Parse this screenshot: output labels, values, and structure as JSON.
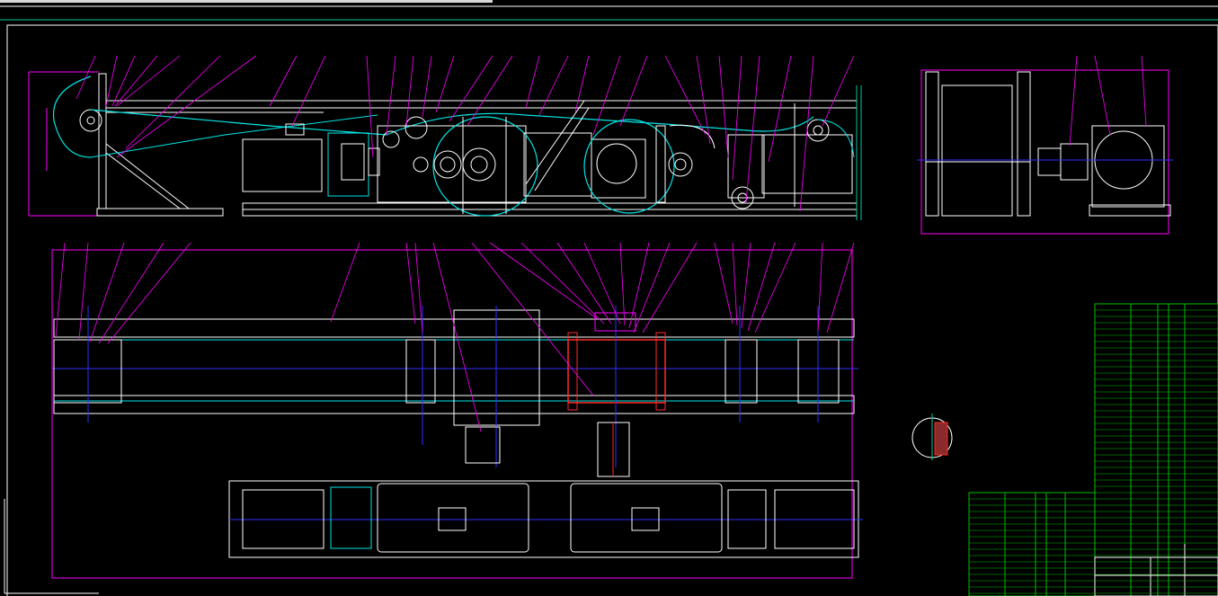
{
  "drawing": {
    "background": "#000000",
    "colors": {
      "frame": "#ffffff",
      "border_accent": "#00c8a0",
      "leader": "#ff00ff",
      "belt": "#00e6e6",
      "centerline": "#2f2fff",
      "highlight": "#ff2a2a",
      "table_grid": "#00c000"
    }
  },
  "views": {
    "side_elevation": "side-view",
    "end_view": "end-view",
    "plan_view": "plan-view",
    "detail": "detail-circle"
  }
}
